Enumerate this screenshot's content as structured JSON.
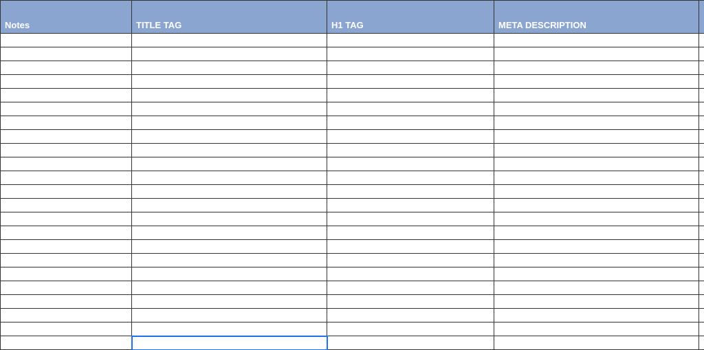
{
  "columns": {
    "notes": "Notes",
    "title_tag": "TITLE TAG",
    "h1_tag": "H1 TAG",
    "meta_description": "META DESCRIPTION"
  },
  "rows": [
    {
      "notes": "",
      "title_tag": "",
      "h1_tag": "",
      "meta_description": ""
    },
    {
      "notes": "",
      "title_tag": "",
      "h1_tag": "",
      "meta_description": ""
    },
    {
      "notes": "",
      "title_tag": "",
      "h1_tag": "",
      "meta_description": ""
    },
    {
      "notes": "",
      "title_tag": "",
      "h1_tag": "",
      "meta_description": ""
    },
    {
      "notes": "",
      "title_tag": "",
      "h1_tag": "",
      "meta_description": ""
    },
    {
      "notes": "",
      "title_tag": "",
      "h1_tag": "",
      "meta_description": ""
    },
    {
      "notes": "",
      "title_tag": "",
      "h1_tag": "",
      "meta_description": ""
    },
    {
      "notes": "",
      "title_tag": "",
      "h1_tag": "",
      "meta_description": ""
    },
    {
      "notes": "",
      "title_tag": "",
      "h1_tag": "",
      "meta_description": ""
    },
    {
      "notes": "",
      "title_tag": "",
      "h1_tag": "",
      "meta_description": ""
    },
    {
      "notes": "",
      "title_tag": "",
      "h1_tag": "",
      "meta_description": ""
    },
    {
      "notes": "",
      "title_tag": "",
      "h1_tag": "",
      "meta_description": ""
    },
    {
      "notes": "",
      "title_tag": "",
      "h1_tag": "",
      "meta_description": ""
    },
    {
      "notes": "",
      "title_tag": "",
      "h1_tag": "",
      "meta_description": ""
    },
    {
      "notes": "",
      "title_tag": "",
      "h1_tag": "",
      "meta_description": ""
    },
    {
      "notes": "",
      "title_tag": "",
      "h1_tag": "",
      "meta_description": ""
    },
    {
      "notes": "",
      "title_tag": "",
      "h1_tag": "",
      "meta_description": ""
    },
    {
      "notes": "",
      "title_tag": "",
      "h1_tag": "",
      "meta_description": ""
    },
    {
      "notes": "",
      "title_tag": "",
      "h1_tag": "",
      "meta_description": ""
    },
    {
      "notes": "",
      "title_tag": "",
      "h1_tag": "",
      "meta_description": ""
    },
    {
      "notes": "",
      "title_tag": "",
      "h1_tag": "",
      "meta_description": ""
    },
    {
      "notes": "",
      "title_tag": "",
      "h1_tag": "",
      "meta_description": ""
    },
    {
      "notes": "",
      "title_tag": "",
      "h1_tag": "",
      "meta_description": ""
    }
  ],
  "selected_cell": {
    "row": 22,
    "col": "title_tag"
  }
}
